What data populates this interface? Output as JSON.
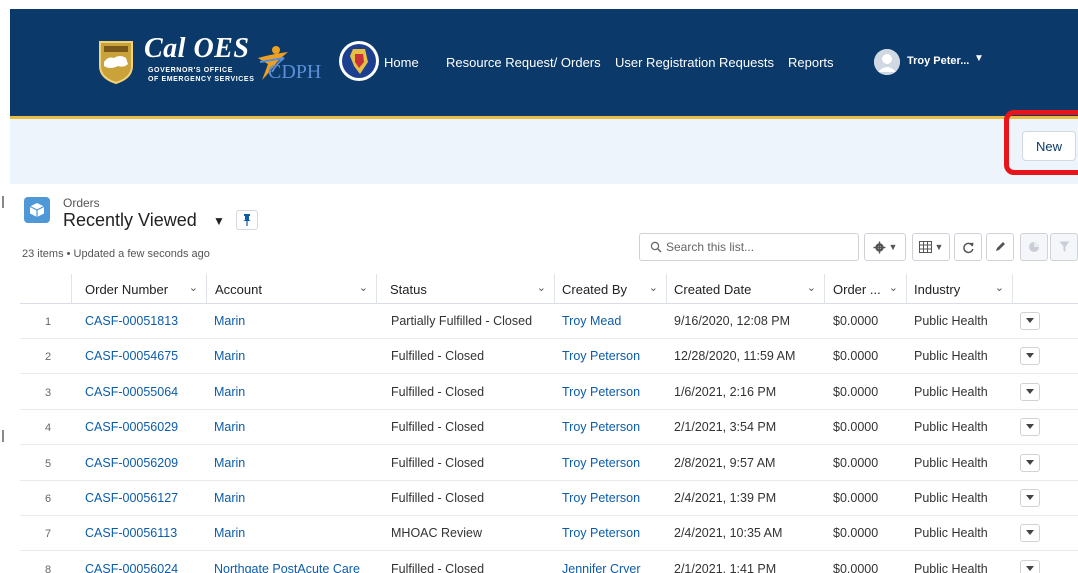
{
  "header": {
    "logo_title": "Cal OES",
    "logo_subtitle_line1": "GOVERNOR'S OFFICE",
    "logo_subtitle_line2": "OF EMERGENCY SERVICES",
    "cdph_text": "CDPH",
    "nav": [
      "Home",
      "Resource Request/ Orders",
      "User Registration Requests",
      "Reports"
    ],
    "user_name": "Troy Peter..."
  },
  "actionbar": {
    "new_label": "New"
  },
  "list": {
    "object_label": "Orders",
    "view_name": "Recently Viewed",
    "meta": "23 items • Updated a few seconds ago",
    "search_placeholder": "Search this list..."
  },
  "table": {
    "columns": [
      "Order Number",
      "Account",
      "Status",
      "Created By",
      "Created Date",
      "Order ...",
      "Industry"
    ],
    "rows": [
      {
        "n": "1",
        "order": "CASF-00051813",
        "account": "Marin",
        "status": "Partially Fulfilled - Closed",
        "created_by": "Troy Mead",
        "date": "9/16/2020, 12:08 PM",
        "amount": "$0.0000",
        "industry": "Public Health"
      },
      {
        "n": "2",
        "order": "CASF-00054675",
        "account": "Marin",
        "status": "Fulfilled - Closed",
        "created_by": "Troy Peterson",
        "date": "12/28/2020, 11:59 AM",
        "amount": "$0.0000",
        "industry": "Public Health"
      },
      {
        "n": "3",
        "order": "CASF-00055064",
        "account": "Marin",
        "status": "Fulfilled - Closed",
        "created_by": "Troy Peterson",
        "date": "1/6/2021, 2:16 PM",
        "amount": "$0.0000",
        "industry": "Public Health"
      },
      {
        "n": "4",
        "order": "CASF-00056029",
        "account": "Marin",
        "status": "Fulfilled - Closed",
        "created_by": "Troy Peterson",
        "date": "2/1/2021, 3:54 PM",
        "amount": "$0.0000",
        "industry": "Public Health"
      },
      {
        "n": "5",
        "order": "CASF-00056209",
        "account": "Marin",
        "status": "Fulfilled - Closed",
        "created_by": "Troy Peterson",
        "date": "2/8/2021, 9:57 AM",
        "amount": "$0.0000",
        "industry": "Public Health"
      },
      {
        "n": "6",
        "order": "CASF-00056127",
        "account": "Marin",
        "status": "Fulfilled - Closed",
        "created_by": "Troy Peterson",
        "date": "2/4/2021, 1:39 PM",
        "amount": "$0.0000",
        "industry": "Public Health"
      },
      {
        "n": "7",
        "order": "CASF-00056113",
        "account": "Marin",
        "status": "MHOAC Review",
        "created_by": "Troy Peterson",
        "date": "2/4/2021, 10:35 AM",
        "amount": "$0.0000",
        "industry": "Public Health"
      },
      {
        "n": "8",
        "order": "CASF-00056024",
        "account": "Northgate PostAcute Care",
        "status": "Fulfilled - Closed",
        "created_by": "Jennifer Cryer",
        "date": "2/1/2021, 1:41 PM",
        "amount": "$0.0000",
        "industry": "Public Health"
      }
    ]
  },
  "colors": {
    "header_bg": "#0b3a6a",
    "header_accent": "#e8bf44",
    "link": "#0b5cab",
    "highlight": "#e8141c",
    "actionbar_bg": "#eef4fb",
    "list_icon_bg": "#4e98d8"
  },
  "icons": [
    "bear-badge-icon",
    "cdph-figure-icon",
    "state-seal-icon",
    "user-avatar-icon",
    "caret-down-icon",
    "orders-box-icon",
    "pin-icon",
    "search-icon",
    "gear-icon",
    "table-view-icon",
    "refresh-icon",
    "edit-icon",
    "chart-icon",
    "filter-icon",
    "row-action-caret-icon"
  ]
}
